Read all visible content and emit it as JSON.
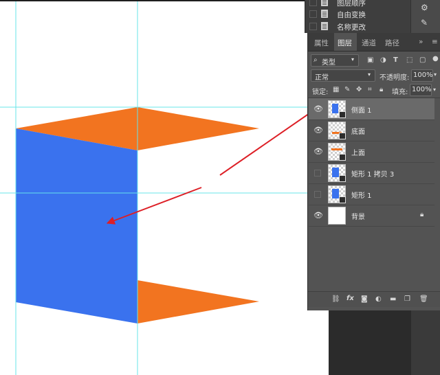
{
  "history": {
    "items": [
      {
        "label": "图层顺序"
      },
      {
        "label": "自由变换"
      },
      {
        "label": "名称更改"
      }
    ]
  },
  "panel": {
    "tabs": [
      {
        "label": "属性"
      },
      {
        "label": "图层"
      },
      {
        "label": "通道"
      },
      {
        "label": "路径"
      }
    ],
    "active_tab": "图层",
    "filter_label": "类型",
    "blend_mode": "正常",
    "opacity_label": "不透明度:",
    "opacity_value": "100%",
    "lock_label": "锁定:",
    "fill_label": "填充:",
    "fill_value": "100%",
    "menu_glyph": "≡",
    "more_glyph": "»"
  },
  "layers": [
    {
      "name": "侧面 1",
      "visible": true,
      "selected": true,
      "thumb": "blue"
    },
    {
      "name": "底面",
      "visible": true,
      "selected": false,
      "thumb": "orange-bottom"
    },
    {
      "name": "上面",
      "visible": true,
      "selected": false,
      "thumb": "orange-top"
    },
    {
      "name": "矩形 1 拷贝 3",
      "visible": false,
      "selected": false,
      "thumb": "blue"
    },
    {
      "name": "矩形 1",
      "visible": false,
      "selected": false,
      "thumb": "blue"
    },
    {
      "name": "背景",
      "visible": true,
      "selected": false,
      "thumb": "white",
      "locked": true
    }
  ],
  "colors": {
    "blue": "#3a72ee",
    "orange": "#f27420",
    "guide": "#67e4ea",
    "arrow": "#dd1f26",
    "panel_bg": "#535353"
  },
  "icons": {
    "bottom_bar": [
      "link-icon",
      "fx-icon",
      "mask-icon",
      "adjustment-icon",
      "folder-icon",
      "new-layer-icon",
      "trash-icon"
    ]
  }
}
